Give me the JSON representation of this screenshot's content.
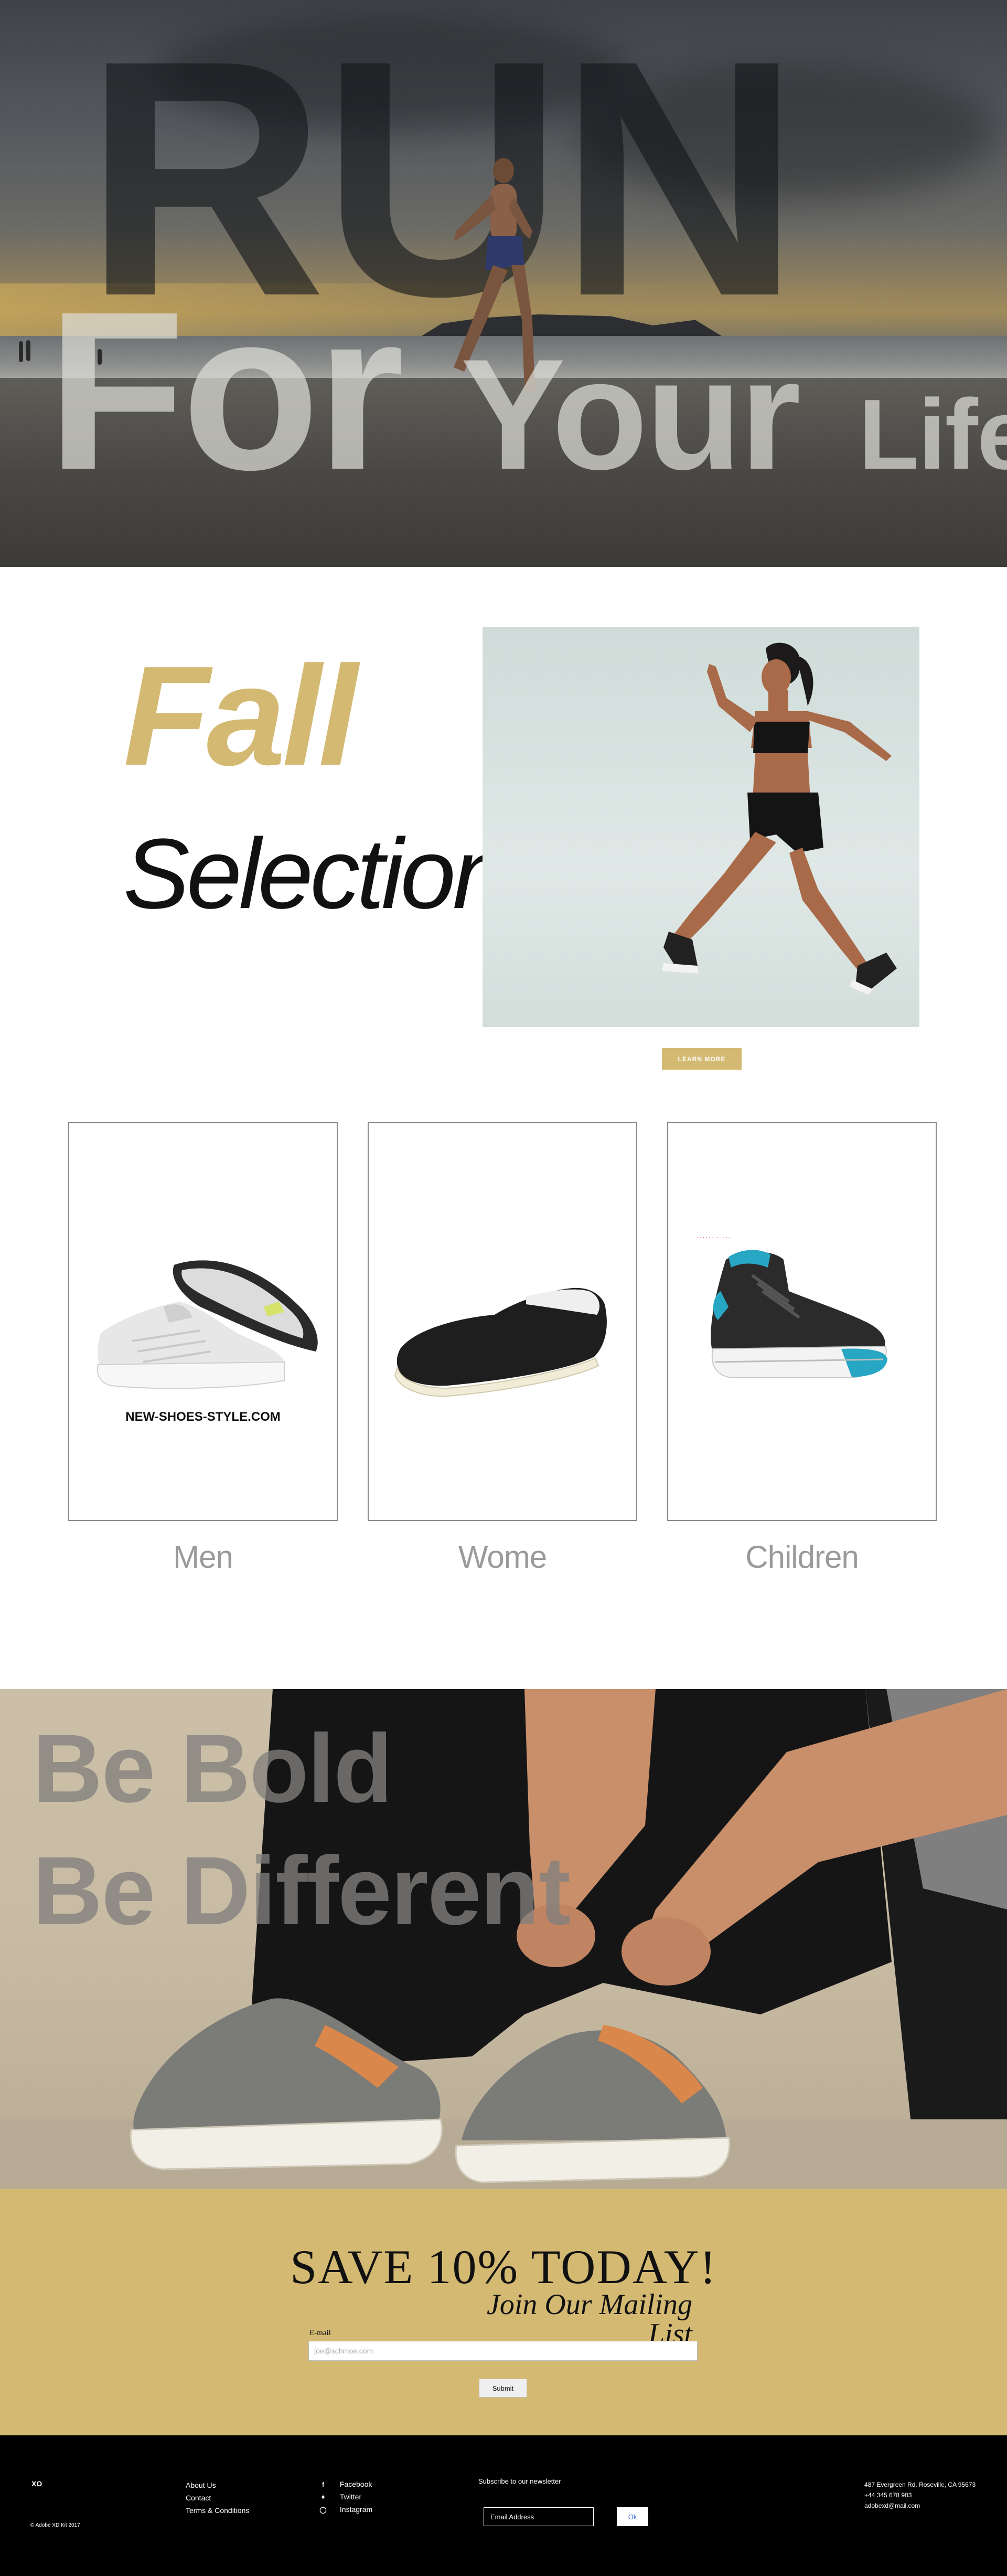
{
  "hero": {
    "headline_big": "RUN",
    "headline_for": "For",
    "headline_your": "Your",
    "headline_life": "Life"
  },
  "fall": {
    "title": "Fall",
    "subtitle": "Selections",
    "learn_more_label": "LEARN MORE"
  },
  "categories": {
    "items": [
      {
        "label": "Men",
        "brand_text": "NEW-SHOES-STYLE.COM"
      },
      {
        "label": "Wome",
        "brand_text": ""
      },
      {
        "label": "Children",
        "fine_print": "· · · · · · · · · · · ·"
      }
    ]
  },
  "bold": {
    "line1": "Be Bold",
    "line2": "Be Different"
  },
  "mailing": {
    "title": "SAVE 10% TODAY!",
    "subtitle": "Join Our Mailing List",
    "email_label": "E-mail",
    "email_placeholder": "joe@schmoe.com",
    "submit_label": "Submit"
  },
  "footer": {
    "logo": "XO",
    "copyright": "© Adobe XD Kit 2017",
    "links": [
      "About Us",
      "Contact",
      "Terms & Conditions"
    ],
    "social": [
      {
        "label": "Facebook",
        "icon": "facebook-icon"
      },
      {
        "label": "Twitter",
        "icon": "twitter-icon"
      },
      {
        "label": "Instagram",
        "icon": "instagram-icon"
      }
    ],
    "newsletter_label": "Subscribe to our newsletter",
    "newsletter_placeholder": "Email Address",
    "ok_label": "Ok",
    "address_line1": "487 Evergreen Rd. Roseville, CA 95673",
    "address_line2": "+44 345 678 903",
    "address_line3": "adobexd@mail.com"
  },
  "colors": {
    "gold": "#d4b972",
    "black": "#000000",
    "card_border": "#8a8a8a"
  }
}
